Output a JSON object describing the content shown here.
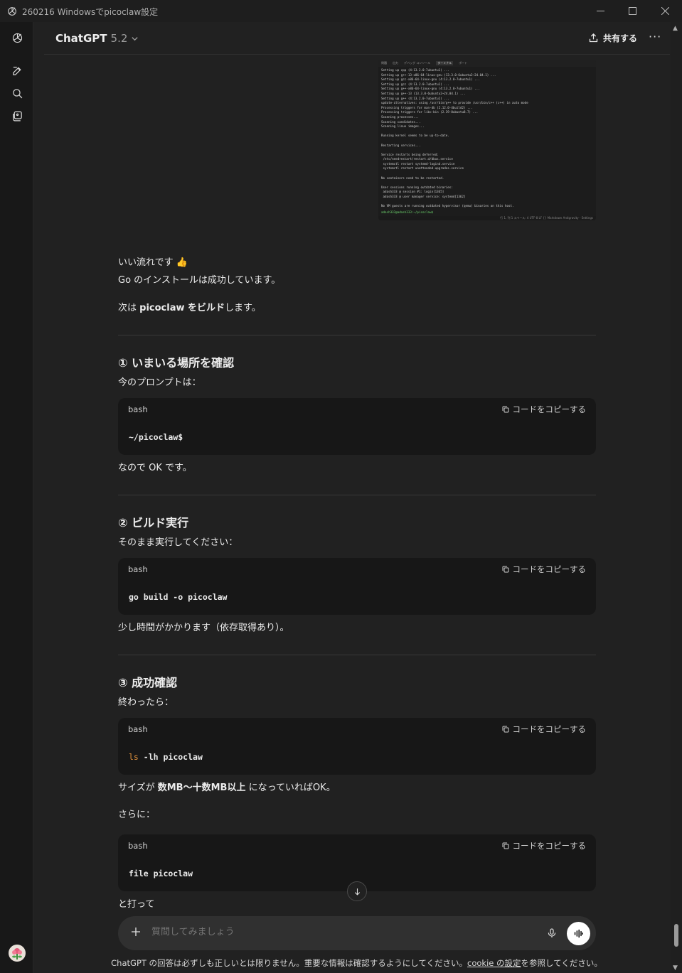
{
  "window": {
    "title": "260216 Windowsでpicoclaw設定"
  },
  "header": {
    "model_name": "ChatGPT",
    "model_version": "5.2",
    "share_label": "共有する",
    "more_label": "···"
  },
  "terminal_screenshot": {
    "tabs": [
      "問題",
      "出力",
      "デバッグ コンソール",
      "ターミナル",
      "ポート"
    ],
    "lines": "Setting up cpp (4:13.2.0-7ubuntu1) ...\nSetting up g++-13-x86-64-linux-gnu (13.3.0-6ubuntu2~24.04.1) ...\nSetting up gcc-x86-64-linux-gnu (4:13.2.0-7ubuntu1) ...\nSetting up gcc (4:13.2.0-7ubuntu1) ...\nSetting up g++-x86-64-linux-gnu (4:13.2.0-7ubuntu1) ...\nSetting up g++-13 (13.3.0-6ubuntu2~24.04.1) ...\nSetting up g++ (4:13.2.0-7ubuntu1) ...\nupdate-alternatives: using /usr/bin/g++ to provide /usr/bin/c++ (c++) in auto mode\nProcessing triggers for man-db (2.12.0-4build2) ...\nProcessing triggers for libc-bin (2.39-0ubuntu8.7) ...\nScanning processes...\nScanning candidates...\nScanning linux images...\n\nRunning kernel seems to be up-to-date.\n\nRestarting services...\n\nService restarts being deferred:\n /etc/needrestart/restart.d/dbus.service\n systemctl restart systemd-logind.service\n systemctl restart unattended-upgrades.service\n\nNo containers need to be restarted.\n\nUser sessions running outdated binaries:\n adash333 @ session #1: login[1365]\n adash333 @ user manager service: systemd[1362]\n\nNo VM guests are running outdated hypervisor (qemu) binaries on this host.",
    "prompt": "adash333@adash333:~/picoclaw$ ",
    "status": "行 1, 列 1   スペース: 4   UTF-8   LF   {} Markdown   Antigravity - Settings"
  },
  "message": {
    "intro_line1": "いい流れです 👍",
    "intro_line2": "Go のインストールは成功しています。",
    "next_prefix": "次は ",
    "next_bold": "picoclaw をビルド",
    "next_suffix": "します。",
    "s1_heading": "① いまいる場所を確認",
    "s1_text": "今のプロンプトは：",
    "s1_after": "なので OK です。",
    "s2_heading": "② ビルド実行",
    "s2_text": "そのまま実行してください：",
    "s2_after": "少し時間がかかります（依存取得あり）。",
    "s3_heading": "③ 成功確認",
    "s3_text": "終わったら：",
    "size_prefix": "サイズが ",
    "size_bold": "数MB〜十数MB以上",
    "size_suffix": " になっていればOK。",
    "further": "さらに：",
    "trailing": "と打って"
  },
  "code_blocks": [
    {
      "lang": "bash",
      "copy_label": "コードをコピーする",
      "code": "~/picoclaw$"
    },
    {
      "lang": "bash",
      "copy_label": "コードをコピーする",
      "code": "go build -o picoclaw"
    },
    {
      "lang": "bash",
      "copy_label": "コードをコピーする",
      "code_cmd": "ls",
      "code_rest": " -lh picoclaw"
    },
    {
      "lang": "bash",
      "copy_label": "コードをコピーする",
      "code": "file picoclaw"
    }
  ],
  "composer": {
    "placeholder": "質問してみましょう"
  },
  "footer": {
    "text": "ChatGPT の回答は必ずしも正しいとは限りません。重要な情報は確認するようにしてください。",
    "link": "cookie の設定",
    "suffix": "を参照してください。"
  },
  "colors": {
    "background": "#212121",
    "code_background": "#171717",
    "keyword_orange": "#e0913c"
  }
}
